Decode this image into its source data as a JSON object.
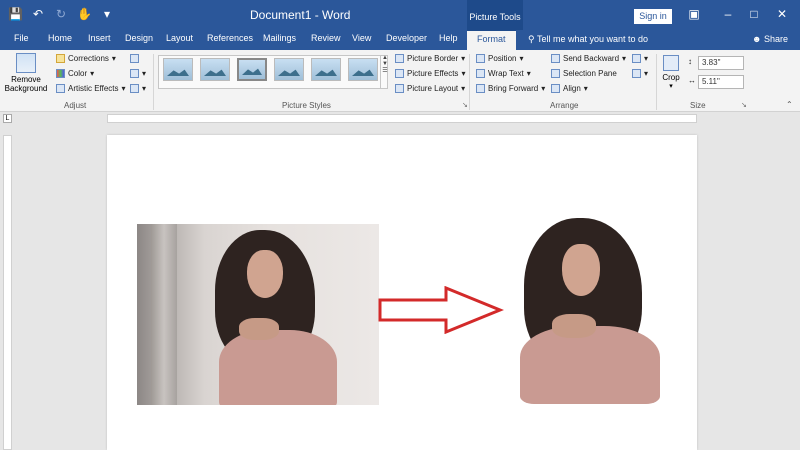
{
  "titlebar": {
    "document_title": "Document1 - Word",
    "contextual_tab_group": "Picture Tools",
    "sign_in": "Sign in"
  },
  "tabs": [
    "File",
    "Home",
    "Insert",
    "Design",
    "Layout",
    "References",
    "Mailings",
    "Review",
    "View",
    "Developer",
    "Help",
    "Format"
  ],
  "tell_me": "Tell me what you want to do",
  "share": "Share",
  "ribbon": {
    "adjust": {
      "remove_background_line1": "Remove",
      "remove_background_line2": "Background",
      "corrections": "Corrections",
      "color": "Color",
      "artistic_effects": "Artistic Effects",
      "label": "Adjust"
    },
    "picture_styles": {
      "label": "Picture Styles",
      "picture_border": "Picture Border",
      "picture_effects": "Picture Effects",
      "picture_layout": "Picture Layout"
    },
    "arrange": {
      "label": "Arrange",
      "position": "Position",
      "wrap_text": "Wrap Text",
      "bring_forward": "Bring Forward",
      "send_backward": "Send Backward",
      "selection_pane": "Selection Pane",
      "align": "Align"
    },
    "size": {
      "label": "Size",
      "crop": "Crop",
      "height": "3.83\"",
      "width": "5.11\""
    }
  },
  "colors": {
    "title_bar": "#2b579a",
    "ribbon_bg": "#f3f3f3",
    "arrow_outline": "#d32a2a"
  }
}
